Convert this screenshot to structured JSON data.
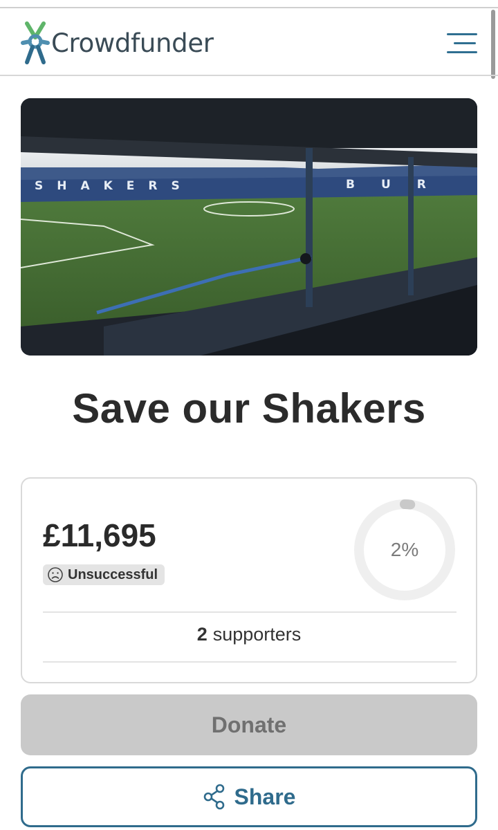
{
  "header": {
    "logo_text": "Crowdfunder",
    "logo_icon": "crowdfunder-person-icon",
    "menu_icon": "hamburger-menu-icon"
  },
  "hero": {
    "stand_left_lettering": "SHAKERS",
    "stand_right_lettering": "BUR"
  },
  "campaign": {
    "title": "Save our Shakers",
    "amount_raised": "£11,695",
    "status": "Unsuccessful",
    "status_icon": "sad-face-icon",
    "progress_label": "2%",
    "progress_fraction": 0.02,
    "supporters_count": "2",
    "supporters_label": "supporters"
  },
  "actions": {
    "donate_label": "Donate",
    "share_label": "Share",
    "share_icon": "share-nodes-icon"
  },
  "colors": {
    "brand_blue": "#2f6b8c",
    "logo_green": "#5fb56a",
    "donate_disabled": "#c9c9c9"
  }
}
